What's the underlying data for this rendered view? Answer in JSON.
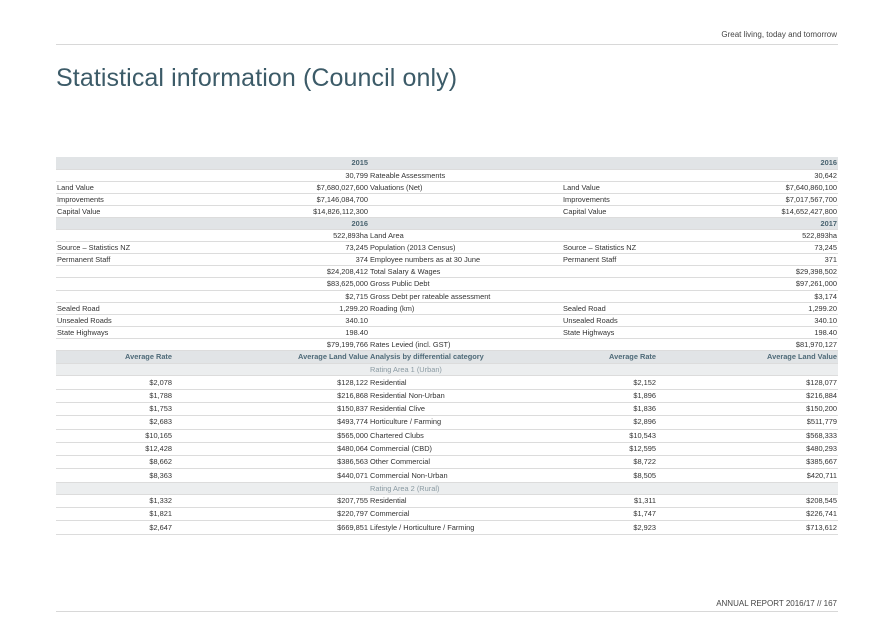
{
  "header": {
    "tagline": "Great living, today and tomorrow"
  },
  "page": {
    "title": "Statistical information (Council only)"
  },
  "footer": {
    "text": "ANNUAL REPORT 2016/17  //  167"
  },
  "section1": {
    "year_left": "2015",
    "year_right": "2016",
    "rows": [
      {
        "l_label": "",
        "l_value": "30,799",
        "center": "Rateable Assessments",
        "r_label": "",
        "r_value": "30,642"
      },
      {
        "l_label": "Land Value",
        "l_value": "$7,680,027,600",
        "center": "Valuations (Net)",
        "r_label": "Land Value",
        "r_value": "$7,640,860,100"
      },
      {
        "l_label": "Improvements",
        "l_value": "$7,146,084,700",
        "center": "",
        "r_label": "Improvements",
        "r_value": "$7,017,567,700"
      },
      {
        "l_label": "Capital Value",
        "l_value": "$14,826,112,300",
        "center": "",
        "r_label": "Capital Value",
        "r_value": "$14,652,427,800"
      }
    ]
  },
  "section2": {
    "year_left": "2016",
    "year_right": "2017",
    "rows": [
      {
        "l_label": "",
        "l_value": "522,893ha",
        "center": "Land Area",
        "r_label": "",
        "r_value": "522,893ha"
      },
      {
        "l_label": "Source – Statistics NZ",
        "l_value": "73,245",
        "center": "Population (2013 Census)",
        "r_label": "Source – Statistics NZ",
        "r_value": "73,245"
      },
      {
        "l_label": "Permanent Staff",
        "l_value": "374",
        "center": "Employee numbers as at 30 June",
        "r_label": "Permanent Staff",
        "r_value": "371"
      },
      {
        "l_label": "",
        "l_value": "$24,208,412",
        "center": "Total Salary & Wages",
        "r_label": "",
        "r_value": "$29,398,502"
      },
      {
        "l_label": "",
        "l_value": "$83,625,000",
        "center": "Gross Public Debt",
        "r_label": "",
        "r_value": "$97,261,000"
      },
      {
        "l_label": "",
        "l_value": "$2,715",
        "center": "Gross Debt per rateable assessment",
        "r_label": "",
        "r_value": "$3,174"
      },
      {
        "l_label": "Sealed Road",
        "l_value": "1,299.20",
        "center": "Roading (km)",
        "r_label": "Sealed Road",
        "r_value": "1,299.20"
      },
      {
        "l_label": "Unsealed Roads",
        "l_value": "340.10",
        "center": "",
        "r_label": "Unsealed Roads",
        "r_value": "340.10"
      },
      {
        "l_label": "State Highways",
        "l_value": "198.40",
        "center": "",
        "r_label": "State Highways",
        "r_value": "198.40"
      },
      {
        "l_label": "",
        "l_value": "$79,199,766",
        "center": "Rates Levied (incl. GST)",
        "r_label": "",
        "r_value": "$81,970,127"
      }
    ]
  },
  "section3": {
    "headers": {
      "avg_rate_left": "Average Rate",
      "avg_land_left": "Average Land Value",
      "center": "Analysis by differential category",
      "avg_rate_right": "Average Rate",
      "avg_land_right": "Average Land Value"
    },
    "area1": {
      "title": "Rating Area 1 (Urban)",
      "rows": [
        {
          "l_rate": "$2,078",
          "l_land": "$128,122",
          "category": "Residential",
          "r_rate": "$2,152",
          "r_land": "$128,077"
        },
        {
          "l_rate": "$1,788",
          "l_land": "$216,868",
          "category": "Residential Non-Urban",
          "r_rate": "$1,896",
          "r_land": "$216,884"
        },
        {
          "l_rate": "$1,753",
          "l_land": "$150,837",
          "category": "Residential Clive",
          "r_rate": "$1,836",
          "r_land": "$150,200"
        },
        {
          "l_rate": "$2,683",
          "l_land": "$493,774",
          "category": "Horticulture / Farming",
          "r_rate": "$2,896",
          "r_land": "$511,779"
        },
        {
          "l_rate": "$10,165",
          "l_land": "$565,000",
          "category": "Chartered Clubs",
          "r_rate": "$10,543",
          "r_land": "$568,333"
        },
        {
          "l_rate": "$12,428",
          "l_land": "$480,064",
          "category": "Commercial (CBD)",
          "r_rate": "$12,595",
          "r_land": "$480,293"
        },
        {
          "l_rate": "$8,662",
          "l_land": "$386,563",
          "category": "Other Commercial",
          "r_rate": "$8,722",
          "r_land": "$385,667"
        },
        {
          "l_rate": "$8,363",
          "l_land": "$440,071",
          "category": "Commercial Non-Urban",
          "r_rate": "$8,505",
          "r_land": "$420,711"
        }
      ]
    },
    "area2": {
      "title": "Rating Area 2 (Rural)",
      "rows": [
        {
          "l_rate": "$1,332",
          "l_land": "$207,755",
          "category": "Residential",
          "r_rate": "$1,311",
          "r_land": "$208,545"
        },
        {
          "l_rate": "$1,821",
          "l_land": "$220,797",
          "category": "Commercial",
          "r_rate": "$1,747",
          "r_land": "$226,741"
        },
        {
          "l_rate": "$2,647",
          "l_land": "$669,851",
          "category": "Lifestyle / Horticulture / Farming",
          "r_rate": "$2,923",
          "r_land": "$713,612"
        }
      ]
    }
  }
}
